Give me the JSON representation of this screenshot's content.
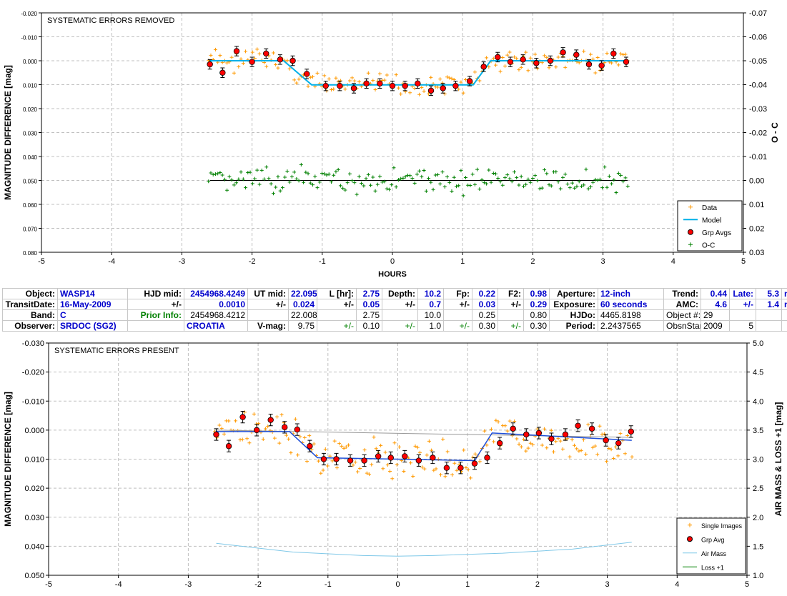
{
  "colors": {
    "data": "#ff9900",
    "model": "#00b0e8",
    "grp": "#ff0000",
    "oc": "#008000",
    "model2": "#1f4fd8",
    "airmass": "#7fc8e8",
    "loss": "#008000",
    "trendline": "#999999",
    "grid": "#bfbfbf"
  },
  "chart_data": [
    {
      "type": "scatter",
      "title": "SYSTEMATIC ERRORS REMOVED",
      "xlabel": "HOURS",
      "ylabel": "MAGNITUDE DIFFERENCE [mag]",
      "y2label": "O - C",
      "xlim": [
        -5,
        5
      ],
      "ylim": [
        -0.02,
        0.08
      ],
      "y_inverted": true,
      "y2lim": [
        -0.07,
        0.03
      ],
      "x_ticks": [
        "-5",
        "-4",
        "-3",
        "-2",
        "-1",
        "0",
        "1",
        "2",
        "3",
        "4",
        "5"
      ],
      "y_ticks": [
        "-0.020",
        "-0.010",
        "0.000",
        "0.010",
        "0.020",
        "0.030",
        "0.040",
        "0.050",
        "0.060",
        "0.070",
        "0.080"
      ],
      "y2_ticks": [
        "-0.07",
        "-0.06",
        "-0.05",
        "-0.04",
        "-0.03",
        "-0.02",
        "-0.01",
        "0.00",
        "0.01",
        "0.02",
        "0.03"
      ],
      "grid": true,
      "legend_position": "bottom-right",
      "legend": [
        "Data",
        "Model",
        "Grp Avgs",
        "O-C"
      ],
      "model": {
        "x": [
          -2.6,
          -1.55,
          -1.15,
          1.15,
          1.4,
          3.35
        ],
        "y": [
          0.0,
          0.0,
          0.0101,
          0.0101,
          0.0,
          0.0
        ]
      },
      "grp_avgs": {
        "x": [
          -2.6,
          -2.42,
          -2.22,
          -2.0,
          -1.8,
          -1.6,
          -1.42,
          -1.22,
          -0.95,
          -0.75,
          -0.55,
          -0.37,
          -0.18,
          0.0,
          0.18,
          0.36,
          0.55,
          0.72,
          0.9,
          1.1,
          1.3,
          1.5,
          1.68,
          1.86,
          2.05,
          2.25,
          2.43,
          2.62,
          2.8,
          2.98,
          3.15,
          3.33
        ],
        "y": [
          0.0015,
          0.005,
          -0.004,
          0.0005,
          -0.003,
          -0.0005,
          0.0,
          0.0055,
          0.0105,
          0.0105,
          0.0115,
          0.0095,
          0.0095,
          0.0105,
          0.0105,
          0.0095,
          0.0125,
          0.0115,
          0.0105,
          0.0085,
          0.0025,
          -0.0015,
          0.0005,
          -0.0005,
          0.001,
          0.0,
          -0.0035,
          -0.0025,
          0.0015,
          0.002,
          -0.003,
          0.0005
        ],
        "err": 0.002
      },
      "oc_baseline": 0.05
    },
    {
      "type": "scatter",
      "title": "SYSTEMATIC ERRORS PRESENT",
      "ylabel": "MAGNITUDE DIFFERENCE [mag]",
      "y2label": "AIR MASS & LOSS +1 [mag]",
      "xlim": [
        -5,
        5
      ],
      "ylim": [
        -0.03,
        0.05
      ],
      "y_inverted": true,
      "y2lim": [
        1.0,
        5.0
      ],
      "x_ticks": [
        "-5",
        "-4",
        "-3",
        "-2",
        "-1",
        "0",
        "1",
        "2",
        "3",
        "4",
        "5"
      ],
      "y_ticks": [
        "-0.030",
        "-0.020",
        "-0.010",
        "0.000",
        "0.010",
        "0.020",
        "0.030",
        "0.040",
        "0.050"
      ],
      "y2_ticks": [
        "1.0",
        "1.5",
        "2.0",
        "2.5",
        "3.0",
        "3.5",
        "4.0",
        "4.5",
        "5.0"
      ],
      "grid": true,
      "legend_position": "bottom-right",
      "legend": [
        "Single Images",
        "Grp Avg",
        "Air Mass",
        "Loss +1"
      ],
      "model": {
        "x": [
          -2.6,
          -1.55,
          -1.15,
          1.1,
          1.35,
          3.35
        ],
        "y": [
          0.0005,
          0.0005,
          0.0095,
          0.0105,
          0.001,
          0.0035
        ]
      },
      "trendline": {
        "x": [
          -2.6,
          3.35
        ],
        "y": [
          0.0,
          0.0025
        ]
      },
      "grp_avgs": {
        "x": [
          -2.6,
          -2.42,
          -2.22,
          -2.02,
          -1.82,
          -1.62,
          -1.44,
          -1.26,
          -1.06,
          -0.88,
          -0.68,
          -0.48,
          -0.28,
          -0.1,
          0.1,
          0.3,
          0.5,
          0.7,
          0.9,
          1.1,
          1.28,
          1.46,
          1.65,
          1.84,
          2.02,
          2.2,
          2.4,
          2.58,
          2.78,
          2.98,
          3.16,
          3.34
        ],
        "y": [
          0.0015,
          0.0055,
          -0.0045,
          0.0,
          -0.0035,
          -0.001,
          -0.0002,
          0.0055,
          0.01,
          0.01,
          0.0105,
          0.0105,
          0.009,
          0.0095,
          0.009,
          0.0105,
          0.0095,
          0.013,
          0.013,
          0.0115,
          0.0095,
          0.0045,
          -0.0005,
          0.0015,
          0.001,
          0.003,
          0.0015,
          -0.0015,
          -0.0005,
          0.0035,
          0.0045,
          0.0005
        ],
        "err": 0.002
      },
      "airmass": {
        "x": [
          -2.6,
          -1.5,
          -0.5,
          0.0,
          0.5,
          1.5,
          2.5,
          3.35
        ],
        "y": [
          1.55,
          1.4,
          1.34,
          1.33,
          1.34,
          1.38,
          1.45,
          1.57
        ]
      }
    }
  ],
  "info": {
    "rows": [
      [
        {
          "t": "Object:",
          "c": "lbl"
        },
        {
          "t": "WASP14",
          "c": "val"
        },
        {
          "t": "HJD mid:",
          "c": "lbl"
        },
        {
          "t": "2454968.4249",
          "c": "val num"
        },
        {
          "t": "UT mid:",
          "c": "lbl"
        },
        {
          "t": "22.095",
          "c": "val num"
        },
        {
          "t": "L [hr]:",
          "c": "lbl"
        },
        {
          "t": "2.75",
          "c": "val num"
        },
        {
          "t": "Depth:",
          "c": "lbl"
        },
        {
          "t": "10.2",
          "c": "val num"
        },
        {
          "t": "Fp:",
          "c": "lbl"
        },
        {
          "t": "0.22",
          "c": "val num"
        },
        {
          "t": "F2:",
          "c": "lbl"
        },
        {
          "t": "0.98",
          "c": "val num"
        },
        {
          "t": "Aperture:",
          "c": "lbl"
        },
        {
          "t": "12-inch",
          "c": "val"
        },
        {
          "t": "Trend:",
          "c": "lbl"
        },
        {
          "t": "0.44",
          "c": "val num"
        },
        {
          "t": "Late:",
          "c": "val num"
        },
        {
          "t": "5.3",
          "c": "val num"
        },
        {
          "t": "min",
          "c": "val"
        }
      ],
      [
        {
          "t": "TransitDate:",
          "c": "lbl"
        },
        {
          "t": "16-May-2009",
          "c": "val"
        },
        {
          "t": "+/-",
          "c": "lbl"
        },
        {
          "t": "0.0010",
          "c": "val num"
        },
        {
          "t": "+/-",
          "c": "lbl"
        },
        {
          "t": "0.024",
          "c": "val num"
        },
        {
          "t": "+/-",
          "c": "lbl"
        },
        {
          "t": "0.05",
          "c": "val num"
        },
        {
          "t": "+/-",
          "c": "lbl"
        },
        {
          "t": "0.7",
          "c": "val num"
        },
        {
          "t": "+/-",
          "c": "lbl"
        },
        {
          "t": "0.03",
          "c": "val num"
        },
        {
          "t": "+/-",
          "c": "lbl"
        },
        {
          "t": "0.29",
          "c": "val num"
        },
        {
          "t": "Exposure:",
          "c": "lbl"
        },
        {
          "t": "60 seconds",
          "c": "val"
        },
        {
          "t": "AMC:",
          "c": "lbl"
        },
        {
          "t": "4.6",
          "c": "val num"
        },
        {
          "t": "+/-",
          "c": "val num"
        },
        {
          "t": "1.4",
          "c": "val num"
        },
        {
          "t": "min",
          "c": "val"
        }
      ],
      [
        {
          "t": "Band:",
          "c": "lbl"
        },
        {
          "t": "C",
          "c": "val"
        },
        {
          "t": "Prior Info:",
          "c": "grn bld num"
        },
        {
          "t": "2454968.4212",
          "c": "plain num"
        },
        {
          "t": "",
          "c": "plain"
        },
        {
          "t": "22.008",
          "c": "plain num"
        },
        {
          "t": "",
          "c": "plain"
        },
        {
          "t": "2.75",
          "c": "plain num"
        },
        {
          "t": "",
          "c": "plain"
        },
        {
          "t": "10.0",
          "c": "plain num"
        },
        {
          "t": "",
          "c": "plain"
        },
        {
          "t": "0.25",
          "c": "plain num"
        },
        {
          "t": "",
          "c": "plain"
        },
        {
          "t": "0.80",
          "c": "plain num"
        },
        {
          "t": "HJDo:",
          "c": "lbl"
        },
        {
          "t": "4465.8198",
          "c": "plain"
        },
        {
          "t": "Object #:",
          "c": "plain num"
        },
        {
          "t": "29",
          "c": "plain"
        },
        {
          "t": "",
          "c": "plain"
        },
        {
          "t": "",
          "c": "plain"
        },
        {
          "t": "",
          "c": "plain"
        }
      ],
      [
        {
          "t": "Observer:",
          "c": "lbl"
        },
        {
          "t": "SRDOC (SG2)",
          "c": "val"
        },
        {
          "t": "",
          "c": "plain"
        },
        {
          "t": "CROATIA",
          "c": "val"
        },
        {
          "t": "V-mag:",
          "c": "lbl"
        },
        {
          "t": "9.75",
          "c": "plain num"
        },
        {
          "t": "+/-",
          "c": "grn num"
        },
        {
          "t": "0.10",
          "c": "plain num"
        },
        {
          "t": "+/-",
          "c": "grn num"
        },
        {
          "t": "1.0",
          "c": "plain num"
        },
        {
          "t": "+/-",
          "c": "grn num"
        },
        {
          "t": "0.30",
          "c": "plain num"
        },
        {
          "t": "+/-",
          "c": "grn num"
        },
        {
          "t": "0.30",
          "c": "plain num"
        },
        {
          "t": "Period:",
          "c": "lbl"
        },
        {
          "t": "2.2437565",
          "c": "plain"
        },
        {
          "t": "ObsnStartDate:",
          "c": "plain num"
        },
        {
          "t": "2009",
          "c": "plain"
        },
        {
          "t": "5",
          "c": "plain num"
        },
        {
          "t": "",
          "c": "plain"
        },
        {
          "t": "16",
          "c": "plain num"
        }
      ]
    ]
  }
}
